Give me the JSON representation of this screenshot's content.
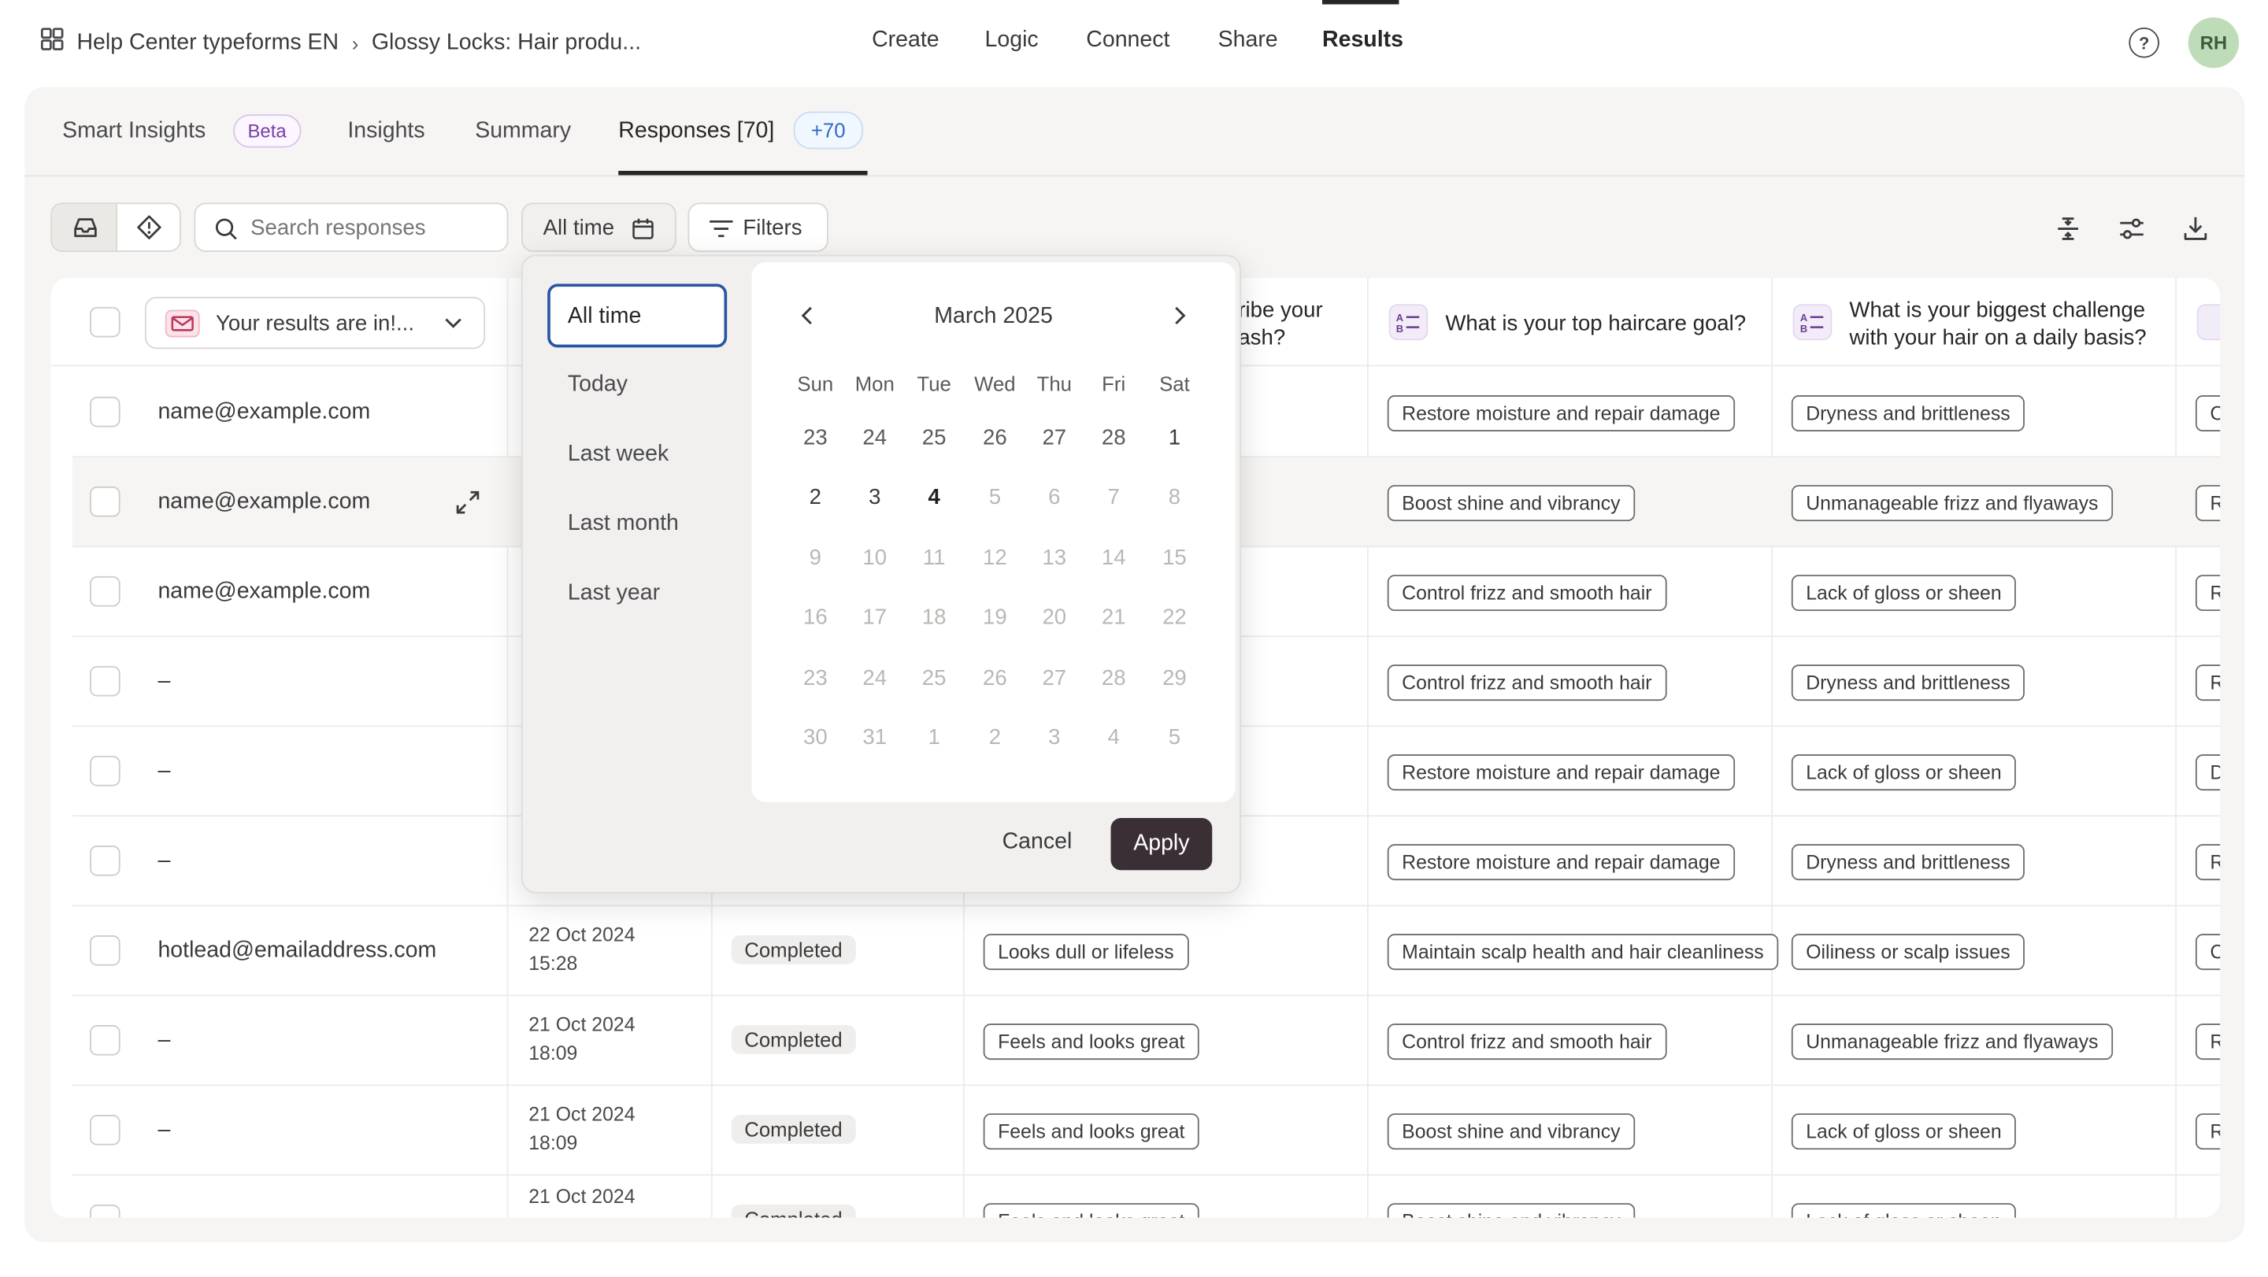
{
  "topbar": {
    "breadcrumb": [
      "Help Center typeforms EN",
      "Glossy Locks: Hair produ..."
    ],
    "nav": [
      "Create",
      "Logic",
      "Connect",
      "Share",
      "Results"
    ],
    "active_nav": "Results",
    "avatar": "RH",
    "help_glyph": "?"
  },
  "subtabs": {
    "items": [
      "Smart Insights",
      "Insights",
      "Summary",
      "Responses [70]"
    ],
    "beta": "Beta",
    "count_badge": "+70",
    "active": "Responses [70]"
  },
  "toolbar": {
    "search_placeholder": "Search responses",
    "time_button": "All time",
    "filters_button": "Filters"
  },
  "table": {
    "results_dropdown": "Your results are in!...",
    "col_partial": [
      "ribe your",
      "ash?"
    ],
    "col_goal": "What is your top haircare goal?",
    "col_challenge": "What is your biggest challenge with your hair on a daily basis?",
    "rows": [
      {
        "email": "name@example.com",
        "date": "",
        "time": "",
        "status": "",
        "c1": "",
        "goal": "Restore moisture and repair damage",
        "challenge": "Dryness and brittleness",
        "next": "C"
      },
      {
        "email": "name@example.com",
        "date": "",
        "time": "",
        "status": "",
        "c1": "",
        "goal": "Boost shine and vibrancy",
        "challenge": "Unmanageable frizz and flyaways",
        "next": "R"
      },
      {
        "email": "name@example.com",
        "date": "",
        "time": "",
        "status": "",
        "c1": "",
        "goal": "Control frizz and smooth hair",
        "challenge": "Lack of gloss or sheen",
        "next": "R"
      },
      {
        "email": "–",
        "date": "",
        "time": "",
        "status": "",
        "c1": "",
        "goal": "Control frizz and smooth hair",
        "challenge": "Dryness and brittleness",
        "next": "R"
      },
      {
        "email": "–",
        "date": "",
        "time": "",
        "status": "",
        "c1": "",
        "goal": "Restore moisture and repair damage",
        "challenge": "Lack of gloss or sheen",
        "next": "D"
      },
      {
        "email": "–",
        "date": "",
        "time": "",
        "status": "",
        "c1": "",
        "goal": "Restore moisture and repair damage",
        "challenge": "Dryness and brittleness",
        "next": "R"
      },
      {
        "email": "hotlead@emailaddress.com",
        "date": "22 Oct 2024",
        "time": "15:28",
        "status": "Completed",
        "c1": "Looks dull or lifeless",
        "goal": "Maintain scalp health and hair cleanliness",
        "challenge": "Oiliness or scalp issues",
        "next": "C"
      },
      {
        "email": "–",
        "date": "21 Oct 2024",
        "time": "18:09",
        "status": "Completed",
        "c1": "Feels and looks great",
        "goal": "Control frizz and smooth hair",
        "challenge": "Unmanageable frizz and flyaways",
        "next": "R"
      },
      {
        "email": "–",
        "date": "21 Oct 2024",
        "time": "18:09",
        "status": "Completed",
        "c1": "Feels and looks great",
        "goal": "Boost shine and vibrancy",
        "challenge": "Lack of gloss or sheen",
        "next": "R"
      },
      {
        "email": "",
        "date": "21 Oct 2024",
        "time": "",
        "status": "Completed",
        "c1": "Feels and looks great",
        "goal": "Boost shine and vibrancy",
        "challenge": "Lack of gloss or sheen",
        "next": ""
      }
    ]
  },
  "datepicker": {
    "ranges": [
      "All time",
      "Today",
      "Last week",
      "Last month",
      "Last year"
    ],
    "selected_range": "All time",
    "month_label": "March 2025",
    "weekdays": [
      "Sun",
      "Mon",
      "Tue",
      "Wed",
      "Thu",
      "Fri",
      "Sat"
    ],
    "weeks": [
      [
        {
          "d": "23",
          "s": "past"
        },
        {
          "d": "24",
          "s": "past"
        },
        {
          "d": "25",
          "s": "past"
        },
        {
          "d": "26",
          "s": "past"
        },
        {
          "d": "27",
          "s": "past"
        },
        {
          "d": "28",
          "s": "past"
        },
        {
          "d": "1",
          "s": "active"
        }
      ],
      [
        {
          "d": "2",
          "s": "active"
        },
        {
          "d": "3",
          "s": "active"
        },
        {
          "d": "4",
          "s": "today"
        },
        {
          "d": "5",
          "s": "disabled"
        },
        {
          "d": "6",
          "s": "disabled"
        },
        {
          "d": "7",
          "s": "disabled"
        },
        {
          "d": "8",
          "s": "disabled"
        }
      ],
      [
        {
          "d": "9",
          "s": "disabled"
        },
        {
          "d": "10",
          "s": "disabled"
        },
        {
          "d": "11",
          "s": "disabled"
        },
        {
          "d": "12",
          "s": "disabled"
        },
        {
          "d": "13",
          "s": "disabled"
        },
        {
          "d": "14",
          "s": "disabled"
        },
        {
          "d": "15",
          "s": "disabled"
        }
      ],
      [
        {
          "d": "16",
          "s": "disabled"
        },
        {
          "d": "17",
          "s": "disabled"
        },
        {
          "d": "18",
          "s": "disabled"
        },
        {
          "d": "19",
          "s": "disabled"
        },
        {
          "d": "20",
          "s": "disabled"
        },
        {
          "d": "21",
          "s": "disabled"
        },
        {
          "d": "22",
          "s": "disabled"
        }
      ],
      [
        {
          "d": "23",
          "s": "disabled"
        },
        {
          "d": "24",
          "s": "disabled"
        },
        {
          "d": "25",
          "s": "disabled"
        },
        {
          "d": "26",
          "s": "disabled"
        },
        {
          "d": "27",
          "s": "disabled"
        },
        {
          "d": "28",
          "s": "disabled"
        },
        {
          "d": "29",
          "s": "disabled"
        }
      ],
      [
        {
          "d": "30",
          "s": "disabled"
        },
        {
          "d": "31",
          "s": "disabled"
        },
        {
          "d": "1",
          "s": "disabled"
        },
        {
          "d": "2",
          "s": "disabled"
        },
        {
          "d": "3",
          "s": "disabled"
        },
        {
          "d": "4",
          "s": "disabled"
        },
        {
          "d": "5",
          "s": "disabled"
        }
      ]
    ],
    "cancel_label": "Cancel",
    "apply_label": "Apply"
  },
  "colors": {
    "accent_blue": "#2b55a3",
    "apply_bg": "#3b2f36",
    "beta_purple": "#7a3fa3",
    "avatar_green": "#bfdcb9"
  },
  "icons": [
    "grid-icon",
    "chevron-right-icon",
    "help-icon",
    "inbox-icon",
    "alert-icon",
    "search-icon",
    "calendar-icon",
    "filter-icon",
    "row-height-icon",
    "settings-sliders-icon",
    "download-icon",
    "mail-icon",
    "chevron-down-icon",
    "expand-icon",
    "list-question-icon",
    "chevron-left-icon"
  ]
}
